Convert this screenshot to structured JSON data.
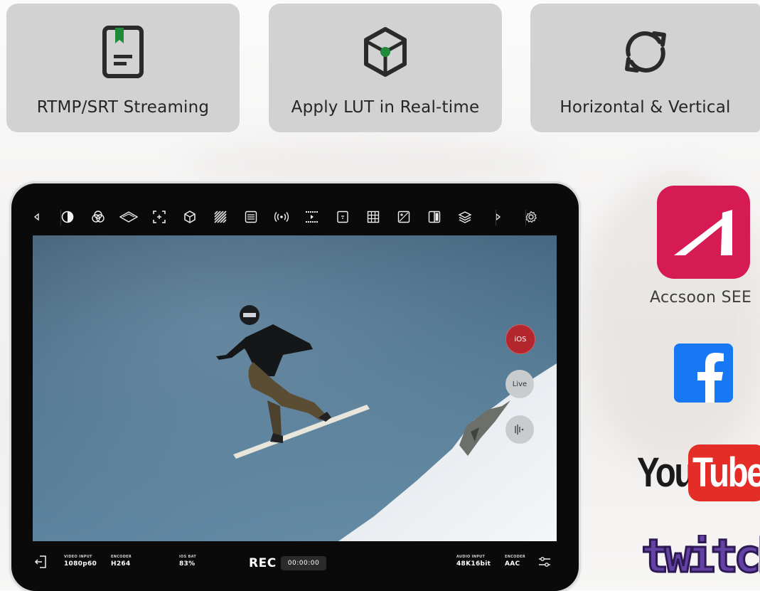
{
  "features": [
    {
      "label": "RTMP/SRT Streaming",
      "icon": "bookmark-document-icon"
    },
    {
      "label": "Apply LUT in Real-time",
      "icon": "cube-icon"
    },
    {
      "label": "Horizontal & Vertical",
      "icon": "rotate-icon"
    }
  ],
  "toolbar": {
    "icons": [
      "chevron-left-icon",
      "contrast-icon",
      "color-circles-icon",
      "waveform-icon",
      "focus-frame-icon",
      "cube-icon",
      "zebra-icon",
      "histogram-icon",
      "broadcast-icon",
      "timeline-icon",
      "frame-guide-icon",
      "grid-icon",
      "exposure-icon",
      "split-compare-icon",
      "layers-icon",
      "chevron-right-icon",
      "gear-icon"
    ]
  },
  "side_buttons": {
    "ios": "iOS",
    "live": "Live",
    "audio": "audio-wave-icon"
  },
  "status": {
    "video_input_label": "VIDEO INPUT",
    "video_input_value": "1080p60",
    "encoder_label": "ENCODER",
    "encoder_value": "H264",
    "ios_bat_label": "iOS BAT",
    "ios_bat_value": "83%",
    "rec_label": "REC",
    "timer": "00:00:00",
    "audio_input_label": "AUDIO INPUT",
    "audio_input_value": "48K16bit",
    "audio_encoder_label": "ENCODER",
    "audio_encoder_value": "AAC"
  },
  "platforms": {
    "accsoon_label": "Accsoon SEE",
    "youtube_you": "You",
    "youtube_tube": "Tube",
    "twitch": "twitch"
  },
  "colors": {
    "card_bg": "#d2d2d2",
    "accent_green": "#1f8a3a",
    "accsoon_red": "#d61b54",
    "facebook_blue": "#1877f2",
    "youtube_red": "#e52d27",
    "twitch_purple": "#6441a5",
    "ios_button": "#b3262e"
  }
}
